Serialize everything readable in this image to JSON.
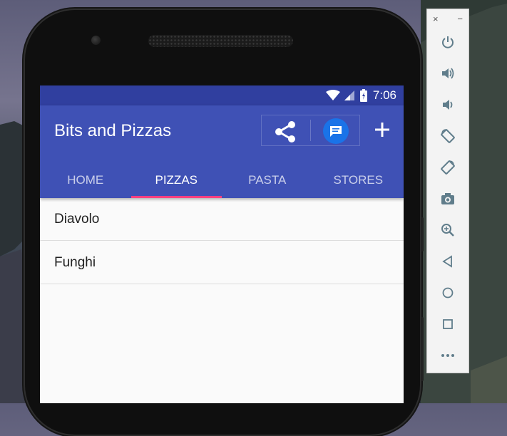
{
  "status_bar": {
    "time": "7:06"
  },
  "app_bar": {
    "title": "Bits and Pizzas",
    "add_label": "+"
  },
  "tabs": [
    {
      "label": "HOME",
      "active": false
    },
    {
      "label": "PIZZAS",
      "active": true
    },
    {
      "label": "PASTA",
      "active": false
    },
    {
      "label": "STORES",
      "active": false
    }
  ],
  "list": {
    "items": [
      "Diavolo",
      "Funghi"
    ]
  },
  "emulator_panel": {
    "close_label": "×",
    "minimize_label": "−",
    "buttons": [
      "power-icon",
      "volume-up-icon",
      "volume-down-icon",
      "rotate-left-icon",
      "rotate-right-icon",
      "camera-icon",
      "zoom-icon",
      "back-icon",
      "home-icon",
      "overview-icon",
      "more-icon"
    ]
  },
  "colors": {
    "status_bar": "#303f9f",
    "app_bar": "#3f51b5",
    "tab_indicator": "#ff4081",
    "message_button": "#1a73e8",
    "list_background": "#fafafa"
  }
}
